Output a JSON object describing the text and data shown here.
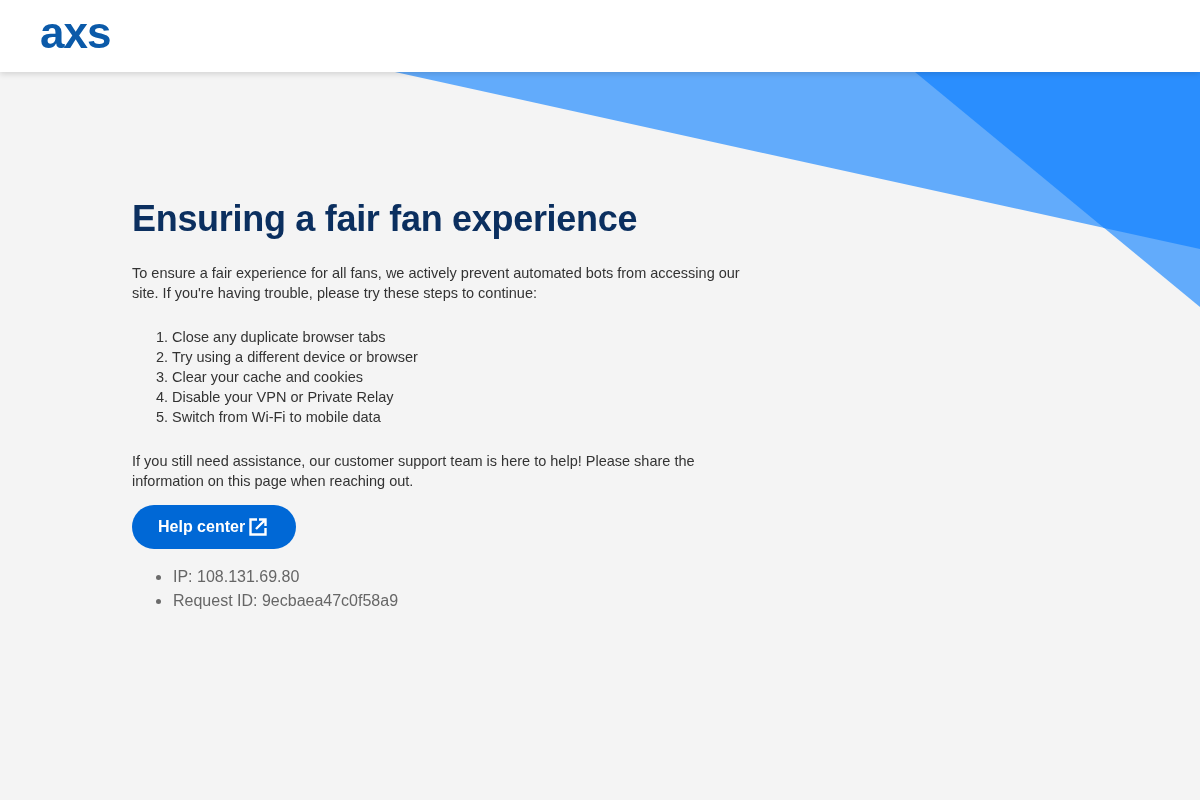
{
  "header": {
    "logo": "axs"
  },
  "heading": "Ensuring a fair fan experience",
  "intro": "To ensure a fair experience for all fans, we actively prevent automated bots from accessing our site. If you're having trouble, please try these steps to continue:",
  "steps": [
    {
      "number": "1.",
      "text": "Close any duplicate browser tabs"
    },
    {
      "number": "2.",
      "text": "Try using a different device or browser"
    },
    {
      "number": "3.",
      "text": "Clear your cache and cookies"
    },
    {
      "number": "4.",
      "text": "Disable your VPN or Private Relay"
    },
    {
      "number": "5.",
      "text": "Switch from Wi-Fi to mobile data"
    }
  ],
  "assistance": "If you still need assistance, our customer support team is here to help! Please share the information on this page when reaching out.",
  "help_button": {
    "label": "Help center"
  },
  "info": [
    "IP: 108.131.69.80",
    "Request ID: 9ecbaea47c0f58a9"
  ]
}
